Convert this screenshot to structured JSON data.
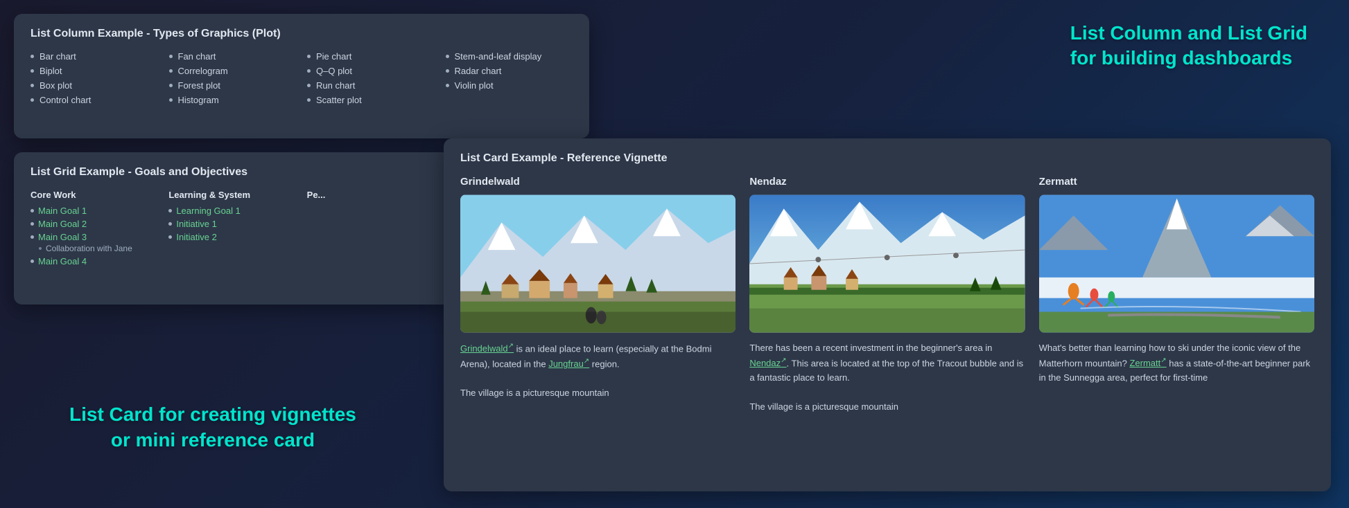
{
  "panel_list_column": {
    "title": "List Column Example - Types of Graphics (Plot)",
    "columns": [
      {
        "items": [
          "Bar chart",
          "Biplot",
          "Box plot",
          "Control chart"
        ]
      },
      {
        "items": [
          "Fan chart",
          "Correlogram",
          "Forest plot",
          "Histogram"
        ]
      },
      {
        "items": [
          "Pie chart",
          "Q–Q plot",
          "Run chart",
          "Scatter plot"
        ]
      },
      {
        "items": [
          "Stem-and-leaf display",
          "Radar chart",
          "Violin plot"
        ]
      }
    ]
  },
  "panel_list_grid": {
    "title": "List Grid Example - Goals and Objectives",
    "columns": [
      {
        "header": "Core Work",
        "items": [
          {
            "text": "Main Goal 1",
            "link": true,
            "subitems": []
          },
          {
            "text": "Main Goal 2",
            "link": true,
            "subitems": []
          },
          {
            "text": "Main Goal 3",
            "link": true,
            "subitems": [
              {
                "text": "Collaboration with Jane"
              }
            ]
          },
          {
            "text": "Main Goal 4",
            "link": true,
            "subitems": []
          }
        ]
      },
      {
        "header": "Learning & System",
        "items": [
          {
            "text": "Learning Goal 1",
            "link": true,
            "subitems": []
          },
          {
            "text": "Initiative 1",
            "link": true,
            "subitems": []
          },
          {
            "text": "Initiative 2",
            "link": true,
            "subitems": []
          }
        ]
      },
      {
        "header": "Pe...",
        "items": []
      }
    ]
  },
  "panel_list_card": {
    "title": "List Card Example - Reference Vignette",
    "cards": [
      {
        "id": "grindelwald",
        "title": "Grindelwald",
        "text_parts": [
          {
            "type": "link",
            "text": "Grindelwald"
          },
          {
            "type": "text",
            "text": " is an ideal place to learn (especially at the Bodmi Arena), located in the "
          },
          {
            "type": "link",
            "text": "Jungfrau"
          },
          {
            "type": "text",
            "text": " region."
          },
          {
            "type": "newline"
          },
          {
            "type": "text",
            "text": "The village is a picturesque mountain"
          }
        ]
      },
      {
        "id": "nendaz",
        "title": "Nendaz",
        "text_parts": [
          {
            "type": "text",
            "text": "There has been a recent investment in the beginner's area in "
          },
          {
            "type": "link",
            "text": "Nendaz"
          },
          {
            "type": "text",
            "text": ". This area is located at the top of the Tracout bubble and is a fantastic place to learn."
          },
          {
            "type": "newline"
          },
          {
            "type": "text",
            "text": "The village is a picturesque mountain"
          }
        ]
      },
      {
        "id": "zermatt",
        "title": "Zermatt",
        "text_parts": [
          {
            "type": "text",
            "text": "What's better than learning how to ski under the iconic view of the Matterhorn mountain? "
          },
          {
            "type": "link",
            "text": "Zermatt"
          },
          {
            "type": "text",
            "text": " has a state-of-the-art beginner park in the Sunnegga area, perfect for first-time"
          }
        ]
      }
    ]
  },
  "floating_labels": {
    "top_right": "List Column and List Grid\nfor building dashboards",
    "top_right_line1": "List Column and List Grid",
    "top_right_line2": "for building dashboards",
    "bottom_left_line1": "List Card for creating vignettes",
    "bottom_left_line2": "or mini reference card"
  }
}
